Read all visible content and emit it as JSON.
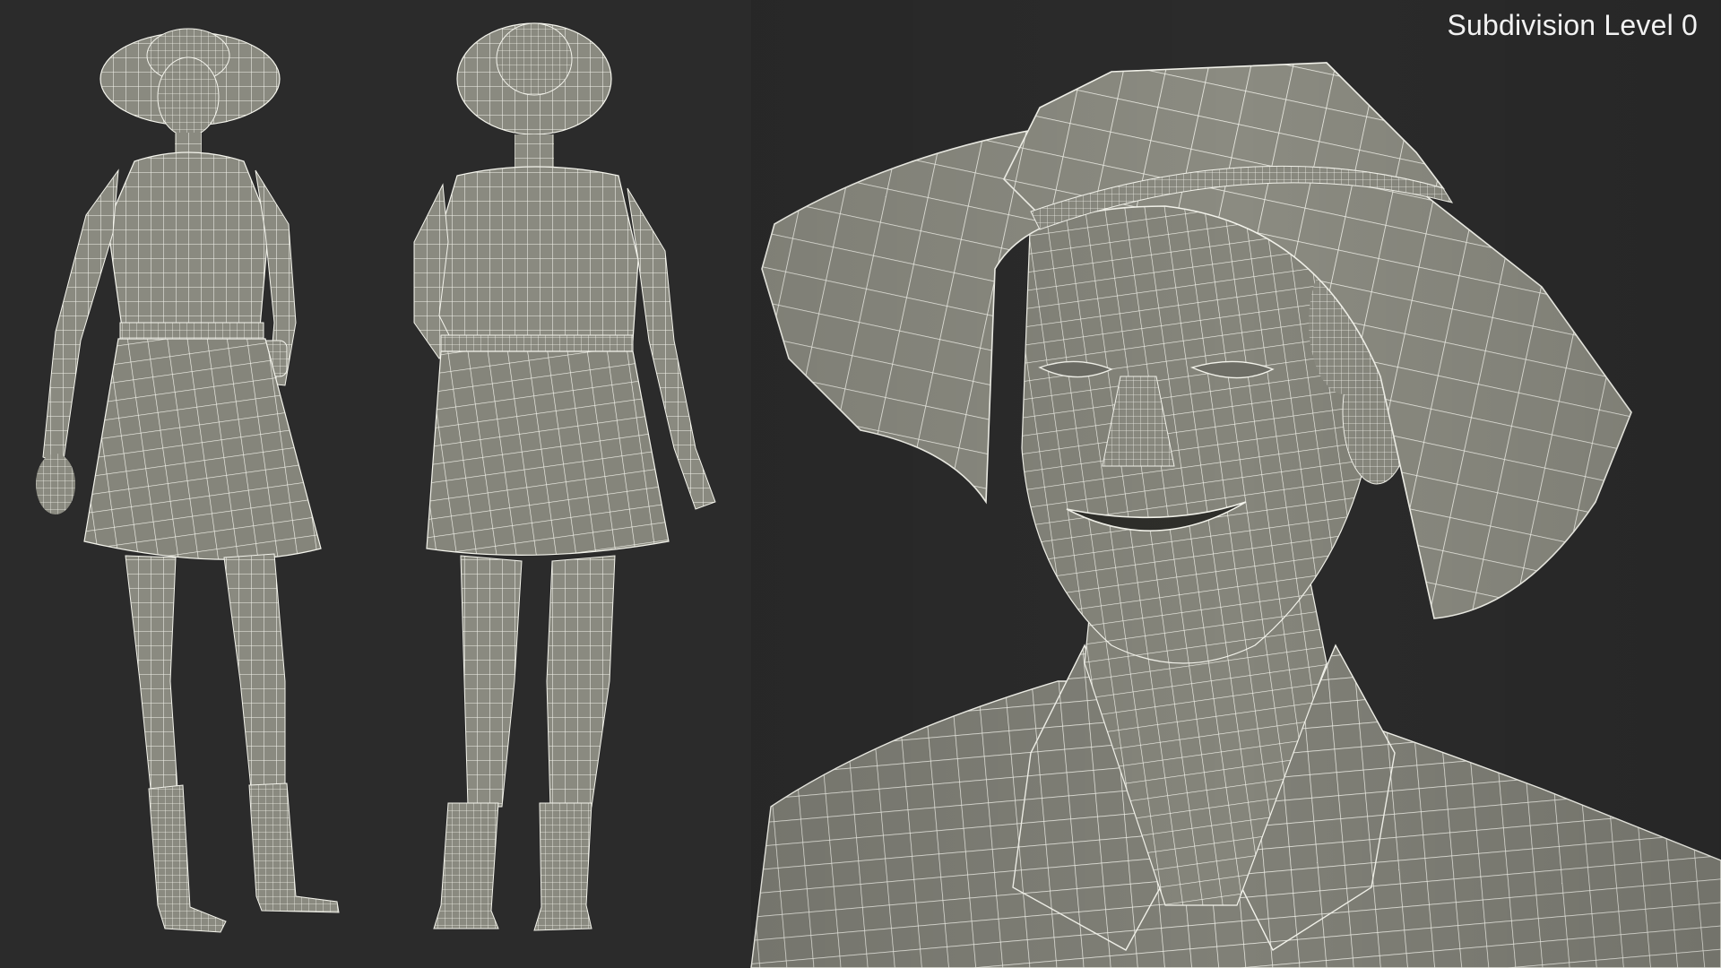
{
  "overlay": {
    "subdivision_label": "Subdivision Level 0"
  },
  "scene": {
    "subject": "wireframe-3d-model",
    "views": [
      "front-view",
      "back-view",
      "head-closeup"
    ],
    "colors": {
      "background": "#2b2b2b",
      "mesh_fill": "#8a8a80",
      "mesh_shadow": "#6e6e66",
      "wire": "#f4f4ec",
      "label": "#f2f2f2"
    }
  }
}
